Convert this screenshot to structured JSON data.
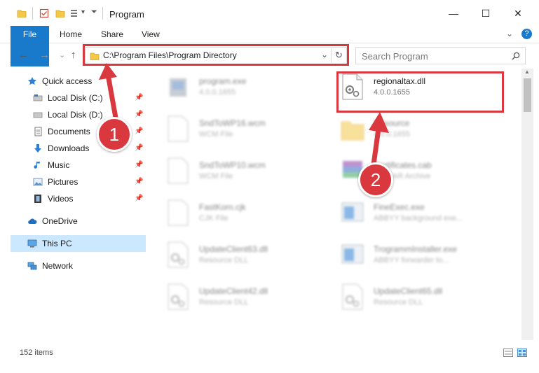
{
  "window": {
    "title": "Program",
    "minimize": "—",
    "maximize": "☐",
    "close": "✕"
  },
  "ribbon": {
    "tabs": [
      "File",
      "Home",
      "Share",
      "View"
    ],
    "help": "?",
    "collapse": "⌄"
  },
  "nav": {
    "back": "←",
    "forward": "→",
    "recent": "⌄",
    "up": "↑",
    "address": "C:\\Program Files\\Program Directory",
    "address_dropdown": "⌄",
    "refresh": "↻",
    "search_placeholder": "Search Program"
  },
  "sidebar": {
    "items": [
      {
        "label": "Quick access",
        "icon": "star-icon",
        "pinned": false
      },
      {
        "label": "Local Disk (C:)",
        "icon": "drive-icon",
        "pinned": true
      },
      {
        "label": "Local Disk (D:)",
        "icon": "drive-icon",
        "pinned": true
      },
      {
        "label": "Documents",
        "icon": "documents-icon",
        "pinned": true
      },
      {
        "label": "Downloads",
        "icon": "download-arrow-icon",
        "pinned": true
      },
      {
        "label": "Music",
        "icon": "music-note-icon",
        "pinned": true
      },
      {
        "label": "Pictures",
        "icon": "pictures-icon",
        "pinned": true
      },
      {
        "label": "Videos",
        "icon": "film-icon",
        "pinned": true
      },
      {
        "label": "OneDrive",
        "icon": "cloud-icon",
        "pinned": false
      },
      {
        "label": "This PC",
        "icon": "monitor-icon",
        "pinned": false,
        "selected": true
      },
      {
        "label": "Network",
        "icon": "network-icon",
        "pinned": false
      }
    ]
  },
  "files": [
    {
      "name": "program.exe",
      "sub": "4.0.0.1655",
      "icon": "exe-icon"
    },
    {
      "name": "regionaltax.dll",
      "sub": "4.0.0.1655",
      "icon": "dll-gear-icon"
    },
    {
      "name": "SndToWP16.wcm",
      "sub": "WCM File",
      "icon": "blank-file-icon"
    },
    {
      "name": "Resource",
      "sub": "4.0.0.1655",
      "icon": "folder-icon"
    },
    {
      "name": "SndToWP10.wcm",
      "sub": "WCM File",
      "icon": "blank-file-icon"
    },
    {
      "name": "Certificates.cab",
      "sub": "WinRAR Archive",
      "icon": "archive-icon"
    },
    {
      "name": "FastKorn.cjk",
      "sub": "CJK File",
      "icon": "blank-file-icon"
    },
    {
      "name": "FineExec.exe",
      "sub": "ABBYY background exe...",
      "icon": "app-window-icon"
    },
    {
      "name": "UpdateClient63.dll",
      "sub": "Resource DLL",
      "icon": "dll-gear-icon"
    },
    {
      "name": "TrogrammInstaller.exe",
      "sub": "ABBYY forwarder to...",
      "icon": "app-window-icon"
    },
    {
      "name": "UpdateClient42.dll",
      "sub": "Resource DLL",
      "icon": "dll-gear-icon"
    },
    {
      "name": "UpdateClient65.dll",
      "sub": "Resource DLL",
      "icon": "dll-gear-icon"
    }
  ],
  "status": {
    "count": "152 items"
  },
  "annotations": {
    "badge1": "1",
    "badge2": "2",
    "accent": "#d9383e"
  },
  "colors": {
    "file_tab": "#1979ca",
    "selection": "#cce8ff"
  }
}
